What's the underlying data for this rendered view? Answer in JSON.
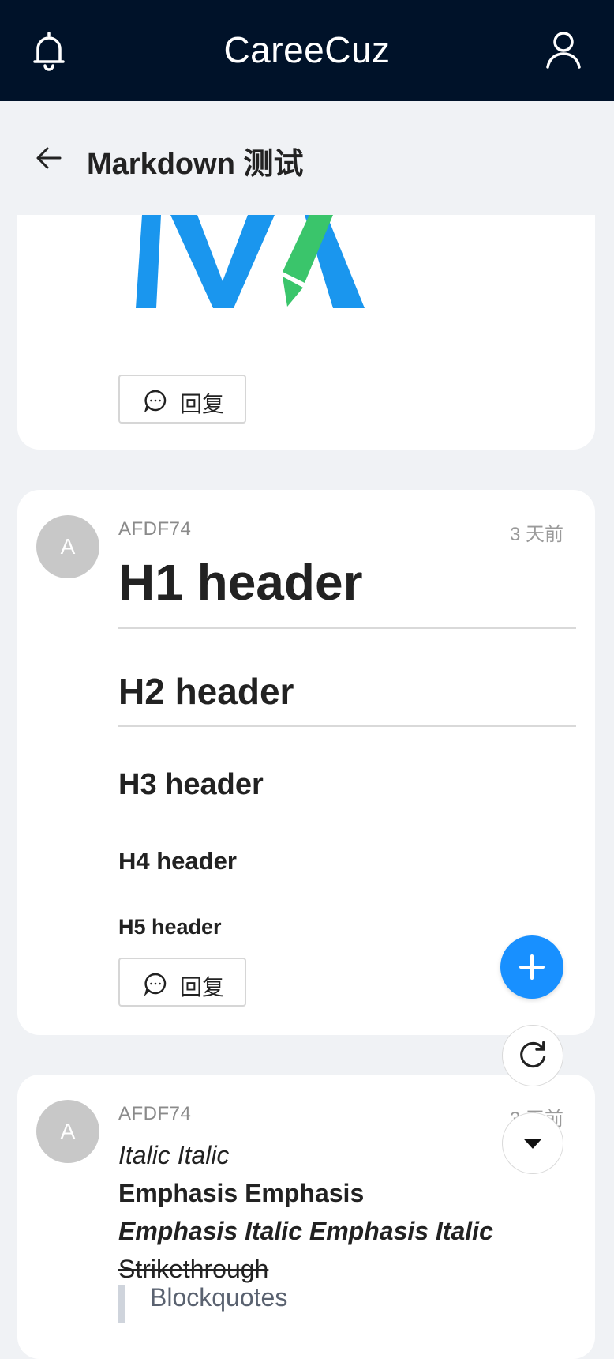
{
  "app": {
    "title": "CareeCuz"
  },
  "page": {
    "title": "Markdown 测试"
  },
  "reply_label": "回复",
  "posts": [
    {
      "author": "AFDF74",
      "avatar_letter": "A",
      "time": "3 天前",
      "h1": "H1 header",
      "h2": "H2 header",
      "h3": "H3 header",
      "h4": "H4 header",
      "h5": "H5 header"
    },
    {
      "author": "AFDF74",
      "avatar_letter": "A",
      "time": "3 天前",
      "italic": "Italic Italic",
      "emphasis": "Emphasis Emphasis",
      "emphasis_italic": "Emphasis Italic Emphasis Italic",
      "strikethrough": "Strikethrough",
      "blockquote": "Blockquotes"
    }
  ],
  "icons": {
    "notifications": "bell-icon",
    "profile": "user-icon",
    "back": "arrow-left-icon",
    "reply": "chat-bubble-icon",
    "add": "plus-icon",
    "refresh": "refresh-icon",
    "scroll_down": "caret-down-icon"
  },
  "colors": {
    "topbar": "#001229",
    "accent": "#1890ff",
    "logo_blue": "#1a96ee",
    "logo_green": "#3ac56b",
    "background": "#f0f2f5"
  }
}
